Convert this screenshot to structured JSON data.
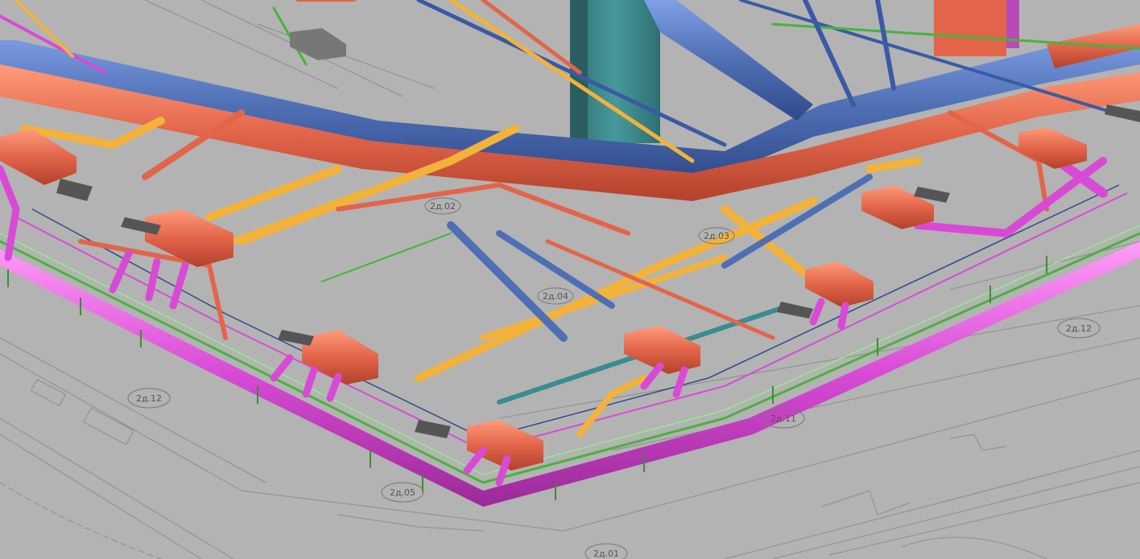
{
  "viewport": {
    "background": "#b3b3b3",
    "floor_line_color": "#8a8a8a",
    "colors": {
      "supply_duct": "#4f6fb5",
      "return_duct": "#e2654a",
      "chilled_pipe": "#f3b23a",
      "refrigerant_pipe": "#d84ad6",
      "cable_tray": "#46b43a",
      "fan_coil_unit": "#e2654a",
      "column": "#3f8c8e"
    }
  },
  "room_tags": [
    {
      "id": "tag-1",
      "label": "2д.12"
    },
    {
      "id": "tag-2",
      "label": "2д.05"
    },
    {
      "id": "tag-3",
      "label": "2д.01"
    },
    {
      "id": "tag-4",
      "label": "2д.11"
    },
    {
      "id": "tag-5",
      "label": "2д.12"
    },
    {
      "id": "tag-6",
      "label": "2д.04"
    },
    {
      "id": "tag-7",
      "label": "2д.03"
    },
    {
      "id": "tag-8",
      "label": "2д.02"
    }
  ]
}
